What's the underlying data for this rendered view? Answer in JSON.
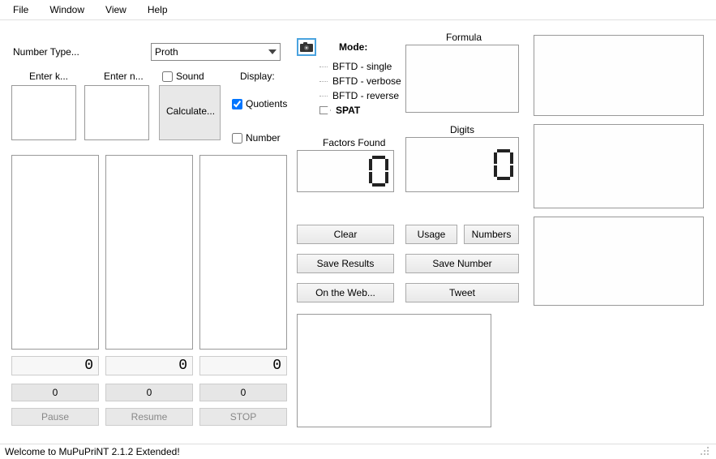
{
  "menu": {
    "file": "File",
    "window": "Window",
    "view": "View",
    "help": "Help"
  },
  "labels": {
    "number_type": "Number Type...",
    "enter_k": "Enter k...",
    "enter_n": "Enter n...",
    "sound": "Sound",
    "display": "Display:",
    "quotients": "Quotients",
    "number": "Number",
    "calculate": "Calculate...",
    "mode": "Mode:",
    "factors_found": "Factors Found",
    "formula": "Formula",
    "digits": "Digits"
  },
  "combo": {
    "number_type_value": "Proth"
  },
  "tree": {
    "items": [
      {
        "label": "BFTD - single",
        "bold": false
      },
      {
        "label": "BFTD - verbose",
        "bold": false
      },
      {
        "label": "BFTD - reverse",
        "bold": false
      },
      {
        "label": "SPAT",
        "bold": true,
        "selected": true
      }
    ]
  },
  "checkboxes": {
    "sound": false,
    "quotients": true,
    "number": false
  },
  "displays": {
    "factors_found": "0",
    "digits": "0",
    "col0_num": "0",
    "col1_num": "0",
    "col2_num": "0",
    "col0_zero": "0",
    "col1_zero": "0",
    "col2_zero": "0"
  },
  "buttons": {
    "clear": "Clear",
    "usage": "Usage",
    "numbers": "Numbers",
    "save_results": "Save Results",
    "save_number": "Save Number",
    "on_web": "On the Web...",
    "tweet": "Tweet",
    "pause": "Pause",
    "resume": "Resume",
    "stop": "STOP"
  },
  "status": "Welcome to MuPuPriNT 2.1.2 Extended!"
}
